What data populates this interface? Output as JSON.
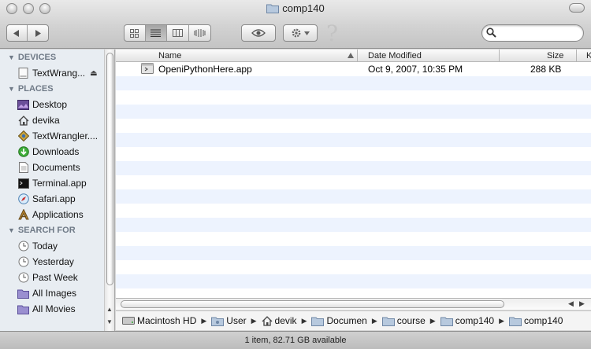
{
  "window": {
    "title": "comp140"
  },
  "toolbar": {
    "view_modes": [
      "icon",
      "list",
      "column",
      "coverflow"
    ],
    "active_view": "list",
    "search": {
      "value": "",
      "placeholder": ""
    }
  },
  "sidebar": {
    "devices_label": "DEVICES",
    "devices": [
      {
        "label": "TextWrang..."
      }
    ],
    "places_label": "PLACES",
    "places": [
      {
        "label": "Desktop"
      },
      {
        "label": "devika"
      },
      {
        "label": "TextWrangler...."
      },
      {
        "label": "Downloads"
      },
      {
        "label": "Documents"
      },
      {
        "label": "Terminal.app"
      },
      {
        "label": "Safari.app"
      },
      {
        "label": "Applications"
      }
    ],
    "search_label": "SEARCH FOR",
    "searches": [
      {
        "label": "Today"
      },
      {
        "label": "Yesterday"
      },
      {
        "label": "Past Week"
      },
      {
        "label": "All Images"
      },
      {
        "label": "All Movies"
      }
    ]
  },
  "list": {
    "columns": {
      "name": "Name",
      "date": "Date Modified",
      "size": "Size",
      "kind": "K"
    },
    "rows": [
      {
        "name": "OpeniPythonHere.app",
        "date": "Oct 9, 2007, 10:35 PM",
        "size": "288 KB"
      }
    ]
  },
  "pathbar": [
    {
      "label": "Macintosh HD",
      "icon": "hard-drive-icon"
    },
    {
      "label": "User",
      "icon": "folder-icon"
    },
    {
      "label": "devik",
      "icon": "home-icon"
    },
    {
      "label": "Documen",
      "icon": "folder-icon"
    },
    {
      "label": "course",
      "icon": "folder-icon"
    },
    {
      "label": "comp140",
      "icon": "folder-icon"
    },
    {
      "label": "comp140",
      "icon": "folder-icon"
    }
  ],
  "status": {
    "text": "1 item, 82.71 GB available"
  },
  "colors": {
    "sidebar_bg": "#e8edf2",
    "row_alt": "#edf3fe",
    "section_text": "#6f7a87"
  }
}
